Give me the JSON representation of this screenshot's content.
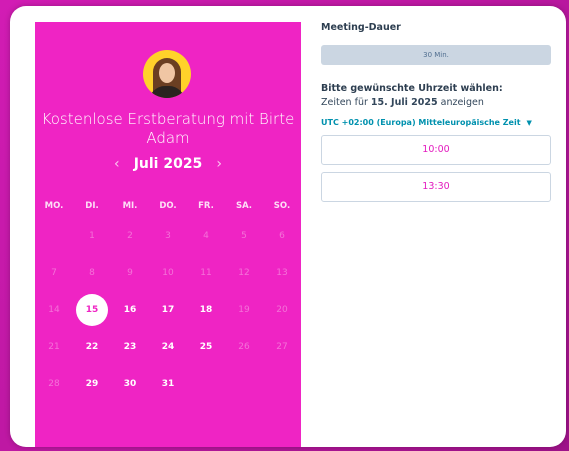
{
  "profile": {
    "title": "Kostenlose Erstberatung mit Birte Adam"
  },
  "calendar": {
    "prev_arrow": "‹",
    "month_label": "Juli 2025",
    "next_arrow": "›",
    "weekdays": [
      "MO.",
      "DI.",
      "MI.",
      "DO.",
      "FR.",
      "SA.",
      "SO."
    ],
    "weeks": [
      [
        {
          "d": ""
        },
        {
          "d": "1",
          "s": "muted"
        },
        {
          "d": "2",
          "s": "muted"
        },
        {
          "d": "3",
          "s": "muted"
        },
        {
          "d": "4",
          "s": "muted"
        },
        {
          "d": "5",
          "s": "muted"
        },
        {
          "d": "6",
          "s": "muted"
        }
      ],
      [
        {
          "d": "7",
          "s": "muted"
        },
        {
          "d": "8",
          "s": "muted"
        },
        {
          "d": "9",
          "s": "muted"
        },
        {
          "d": "10",
          "s": "muted"
        },
        {
          "d": "11",
          "s": "muted"
        },
        {
          "d": "12",
          "s": "muted"
        },
        {
          "d": "13",
          "s": "muted"
        }
      ],
      [
        {
          "d": "14",
          "s": "muted"
        },
        {
          "d": "15",
          "s": "selected"
        },
        {
          "d": "16",
          "s": "avail"
        },
        {
          "d": "17",
          "s": "avail"
        },
        {
          "d": "18",
          "s": "avail"
        },
        {
          "d": "19",
          "s": "muted"
        },
        {
          "d": "20",
          "s": "muted"
        }
      ],
      [
        {
          "d": "21",
          "s": "muted"
        },
        {
          "d": "22",
          "s": "avail"
        },
        {
          "d": "23",
          "s": "avail"
        },
        {
          "d": "24",
          "s": "avail"
        },
        {
          "d": "25",
          "s": "avail"
        },
        {
          "d": "26",
          "s": "muted"
        },
        {
          "d": "27",
          "s": "muted"
        }
      ],
      [
        {
          "d": "28",
          "s": "muted"
        },
        {
          "d": "29",
          "s": "avail"
        },
        {
          "d": "30",
          "s": "avail"
        },
        {
          "d": "31",
          "s": "avail"
        },
        {
          "d": ""
        },
        {
          "d": ""
        },
        {
          "d": ""
        }
      ]
    ]
  },
  "booking": {
    "duration_label": "Meeting-Dauer",
    "duration_value": "30 Min.",
    "pick_label": "Bitte gewünschte Uhrzeit wählen:",
    "showing_prefix": "Zeiten für ",
    "showing_date": "15. Juli 2025",
    "showing_suffix": " anzeigen",
    "timezone": "UTC +02:00 (Europa) Mitteleuropäische Zeit",
    "slots": [
      "10:00",
      "13:30"
    ]
  },
  "colors": {
    "accent": "#ef24c4",
    "link": "#0091ae"
  }
}
